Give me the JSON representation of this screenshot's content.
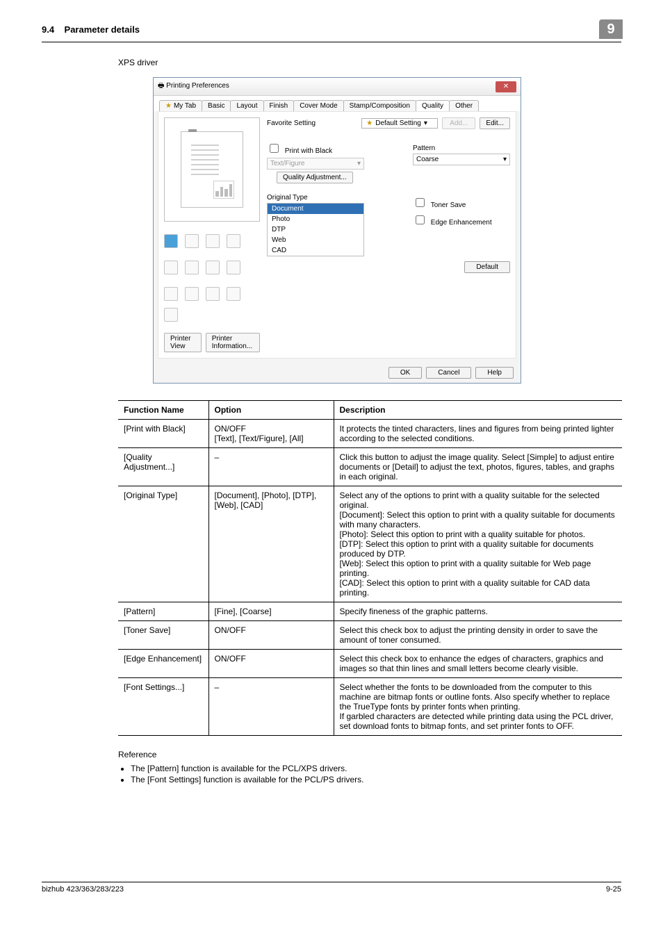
{
  "header": {
    "section_no": "9.4",
    "section_title": "Parameter details",
    "chap_no": "9"
  },
  "sub_heading": "XPS driver",
  "dialog": {
    "title": "Printing Preferences",
    "tabs": [
      "My Tab",
      "Basic",
      "Layout",
      "Finish",
      "Cover Mode",
      "Stamp/Composition",
      "Quality",
      "Other"
    ],
    "active_tab": "Quality",
    "fav_label": "Favorite Setting",
    "fav_value": "Default Setting",
    "btn_add": "Add...",
    "btn_edit": "Edit...",
    "chk_print_black": "Print with Black",
    "dd_textfigure": "Text/Figure",
    "btn_qa": "Quality Adjustment...",
    "orig_type_label": "Original Type",
    "orig_list": [
      "Document",
      "Photo",
      "DTP",
      "Web",
      "CAD"
    ],
    "orig_selected": "Document",
    "pattern_label": "Pattern",
    "pattern_value": "Coarse",
    "chk_toner": "Toner Save",
    "chk_edge": "Edge Enhancement",
    "btn_pv": "Printer View",
    "btn_pi": "Printer Information...",
    "btn_default": "Default",
    "btn_ok": "OK",
    "btn_cancel": "Cancel",
    "btn_help": "Help"
  },
  "table": {
    "head": {
      "c1": "Function Name",
      "c2": "Option",
      "c3": "Description"
    },
    "rows": [
      {
        "c1": "[Print with Black]",
        "c2": "ON/OFF\n[Text], [Text/Figure], [All]",
        "c3": "It protects the tinted characters, lines and figures from being printed lighter according to the selected conditions."
      },
      {
        "c1": "[Quality Adjustment...]",
        "c2": "–",
        "c3": "Click this button to adjust the image quality. Select [Simple] to adjust entire documents or [Detail] to adjust the text, photos, figures, tables, and graphs in each original."
      },
      {
        "c1": "[Original Type]",
        "c2": "[Document], [Photo], [DTP], [Web], [CAD]",
        "c3": "Select any of the options to print with a quality suitable for the selected original.\n[Document]: Select this option to print with a quality suitable for documents with many characters.\n[Photo]: Select this option to print with a quality suitable for photos.\n[DTP]: Select this option to print with a quality suitable for documents produced by DTP.\n[Web]: Select this option to print with a quality suitable for Web page printing.\n[CAD]: Select this option to print with a quality suitable for CAD data printing."
      },
      {
        "c1": "[Pattern]",
        "c2": "[Fine], [Coarse]",
        "c3": "Specify fineness of the graphic patterns."
      },
      {
        "c1": "[Toner Save]",
        "c2": "ON/OFF",
        "c3": "Select this check box to adjust the printing density in order to save the amount of toner consumed."
      },
      {
        "c1": "[Edge Enhancement]",
        "c2": "ON/OFF",
        "c3": "Select this check box to enhance the edges of characters, graphics and images so that thin lines and small letters become clearly visible."
      },
      {
        "c1": "[Font Settings...]",
        "c2": "–",
        "c3": "Select whether the fonts to be downloaded from the computer to this machine are bitmap fonts or outline fonts. Also specify whether to replace the TrueType fonts by printer fonts when printing.\nIf garbled characters are detected while printing data using the PCL driver, set download fonts to bitmap fonts, and set printer fonts to OFF."
      }
    ]
  },
  "ref_heading": "Reference",
  "bullets": [
    "The [Pattern] function is available for the PCL/XPS drivers.",
    "The [Font Settings] function is available for the PCL/PS drivers."
  ],
  "footer": {
    "left": "bizhub 423/363/283/223",
    "right": "9-25"
  }
}
